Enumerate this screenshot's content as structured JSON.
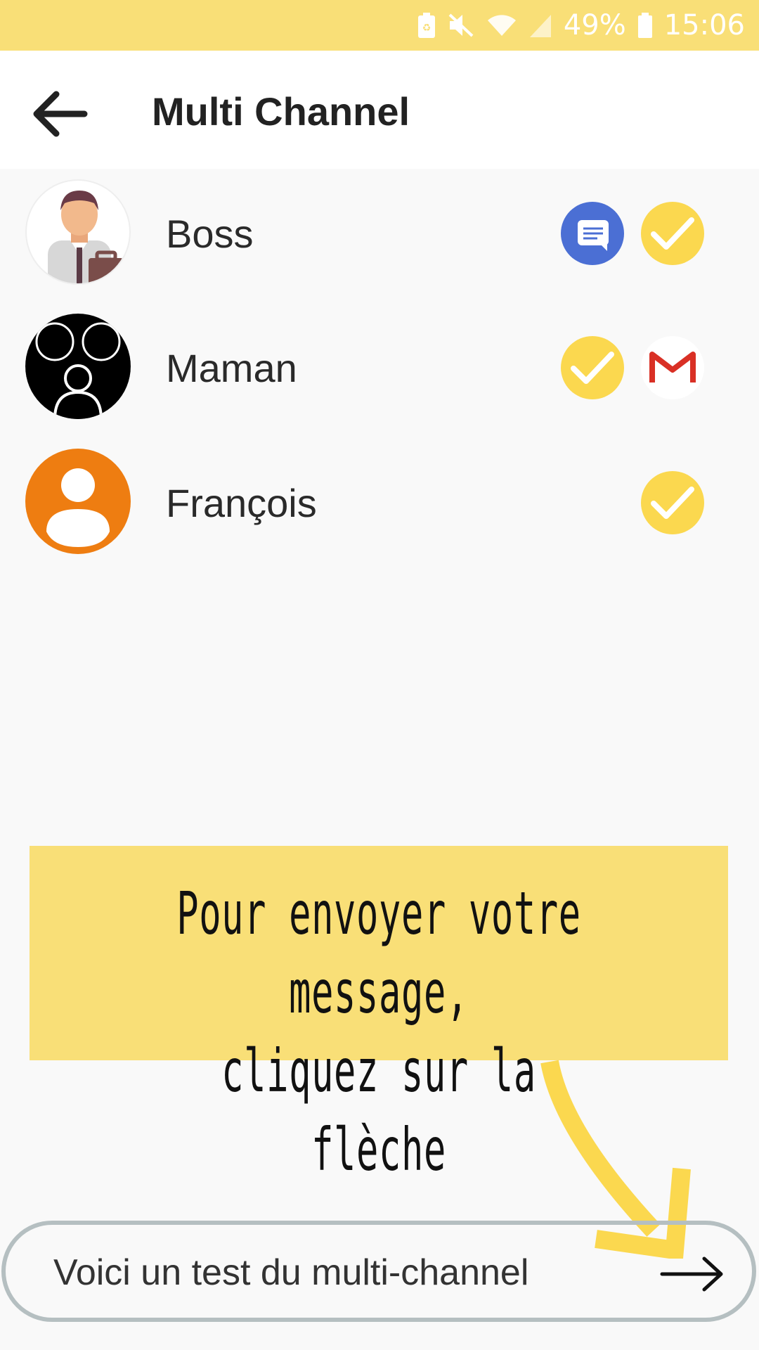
{
  "status_bar": {
    "battery_percent": "49%",
    "time": "15:06",
    "icons": [
      "battery-saver-icon",
      "mute-icon",
      "wifi-icon",
      "signal-icon",
      "battery-icon"
    ]
  },
  "app_bar": {
    "title": "Multi Channel",
    "back_icon": "arrow-back-icon"
  },
  "contacts": [
    {
      "name": "Boss",
      "avatar": "businessman-avatar",
      "channels": [
        "sms-icon",
        "check-icon"
      ]
    },
    {
      "name": "Maman",
      "avatar": "family-avatar",
      "channels": [
        "check-icon",
        "gmail-icon"
      ]
    },
    {
      "name": "François",
      "avatar": "person-avatar",
      "channels": [
        "check-icon"
      ]
    }
  ],
  "callout": {
    "line1": "Pour envoyer votre message,",
    "line2": "cliquez sur la flèche"
  },
  "composer": {
    "value": "Voici un test du multi-channel",
    "send_icon": "arrow-forward-icon"
  },
  "colors": {
    "accent": "#f9df77",
    "check": "#fbd84f",
    "sms": "#4b6fd4",
    "person_avatar": "#ee7d11"
  }
}
